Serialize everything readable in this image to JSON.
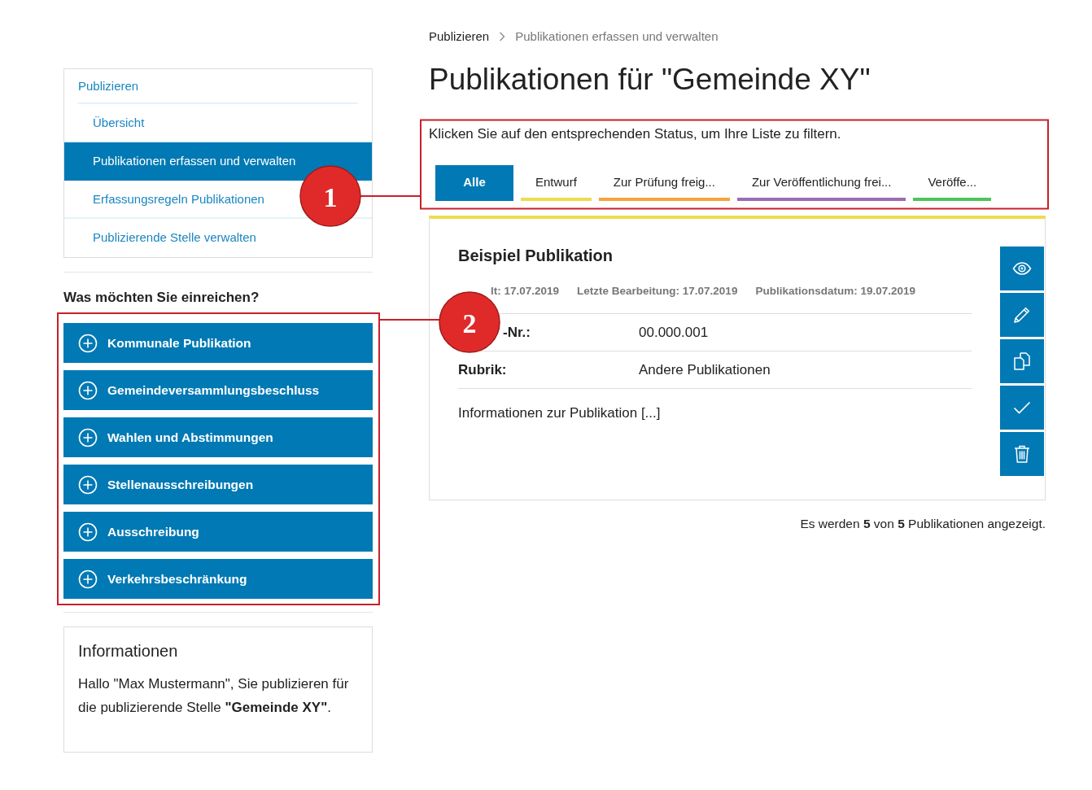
{
  "breadcrumb": [
    {
      "label": "Publizieren"
    },
    {
      "label": "Publikationen erfassen und verwalten"
    }
  ],
  "sidebar": {
    "nav": {
      "title": "Publizieren",
      "items": [
        {
          "label": "Übersicht",
          "selected": false
        },
        {
          "label": "Publikationen erfassen und verwalten",
          "selected": true
        },
        {
          "label": "Erfassungsregeln Publikationen",
          "selected": false
        },
        {
          "label": "Publizierende Stelle verwalten",
          "selected": false
        }
      ]
    },
    "submit_heading": "Was möchten Sie einreichen?",
    "submit_buttons": [
      {
        "label": "Kommunale Publikation"
      },
      {
        "label": "Gemeindeversammlungsbeschluss"
      },
      {
        "label": "Wahlen und Abstimmungen"
      },
      {
        "label": "Stellenausschreibungen"
      },
      {
        "label": "Ausschreibung"
      },
      {
        "label": "Verkehrsbeschränkung"
      }
    ],
    "info": {
      "title": "Informationen",
      "text": "Hallo \"Max Mustermann\", Sie publizieren für die publizierende Stelle **\"Gemeinde XY\"**."
    }
  },
  "main": {
    "title": "Publikationen für \"Gemeinde XY\"",
    "filter_hint": "Klicken Sie auf den entsprechenden Status, um Ihre Liste zu filtern.",
    "tabs": [
      {
        "label": "Alle",
        "selected": true,
        "color": "#0079b4"
      },
      {
        "label": "Entwurf",
        "selected": false,
        "color": "#eedc4e"
      },
      {
        "label": "Zur Prüfung freig...",
        "selected": false,
        "color": "#f7a23c"
      },
      {
        "label": "Zur Veröffentlichung frei...",
        "selected": false,
        "color": "#9c6cb4"
      },
      {
        "label": "Veröffe...",
        "selected": false,
        "color": "#4cc45a"
      }
    ],
    "publication": {
      "color": "#eedc4e",
      "title": "Beispiel Publikation",
      "meta": [
        "lt: 17.07.2019",
        "Letzte Bearbeitung: 17.07.2019",
        "Publikationsdatum: 19.07.2019"
      ],
      "fields": [
        {
          "label": "-Nr.:",
          "value": "00.000.001"
        },
        {
          "label": "Rubrik:",
          "value": "Andere Publikationen"
        }
      ],
      "description": "Informationen zur Publikation [...]",
      "actions": [
        {
          "kind": "view"
        },
        {
          "kind": "edit"
        },
        {
          "kind": "copy"
        },
        {
          "kind": "approve"
        },
        {
          "kind": "delete"
        }
      ]
    },
    "summary": "Es werden **5** von **5** Publikationen angezeigt."
  },
  "annotations": [
    {
      "label": "1"
    },
    {
      "label": "2"
    }
  ]
}
